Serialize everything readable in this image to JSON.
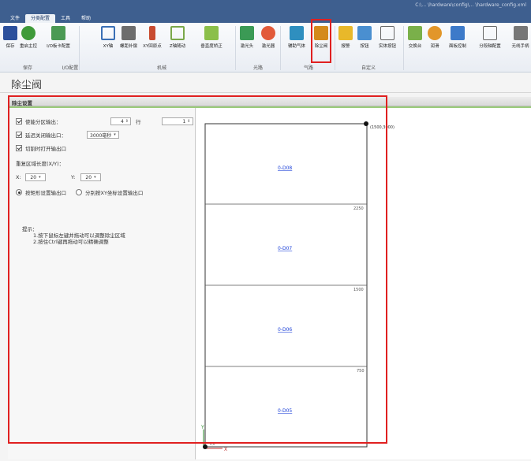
{
  "window": {
    "path_text": "C:\\... \\hardware\\config\\... \\hardware_config.xml"
  },
  "tabs": [
    "文件",
    "分类配置",
    "工具",
    "帮助"
  ],
  "ribbon": {
    "buttons": [
      "保存",
      "重启主控",
      "I/O板卡配置",
      "XY轴",
      "螺距补偿",
      "XY回原点",
      "Z轴随动",
      "垂直度矫正",
      "激光头",
      "激光器",
      "辅助气体",
      "除尘阀",
      "报警",
      "按钮",
      "实体按钮",
      "交换台",
      "润滑",
      "面板控制",
      "分段轴配置",
      "无线手柄"
    ],
    "groups": [
      "保存",
      "I/O配置",
      "机械",
      "光路",
      "气路",
      "自定义"
    ]
  },
  "page": {
    "title": "除尘阀",
    "section": "除尘设置"
  },
  "form": {
    "zone_output": {
      "label": "使能分区输出：",
      "rows": "4",
      "rows_unit": "行",
      "cols": "1",
      "cols_unit": "列"
    },
    "delay_close": {
      "label": "延迟关闭输出口：",
      "value": "3000毫秒"
    },
    "cut_open": {
      "label": "切割时打开输出口"
    },
    "repeat_len": {
      "label": "重复区域长度(X/Y)："
    },
    "x": {
      "label": "X:",
      "value": "20"
    },
    "y": {
      "label": "Y:",
      "value": "20"
    },
    "mode": {
      "option_a": "按矩形设置输出口",
      "option_b": "分别按XY坐标设置输出口"
    }
  },
  "hint": {
    "title": "提示：",
    "line1": "1.按下鼠标左键并拖动可以调整除尘区域",
    "line2": "2.按住Ctrl键再拖动可以精确调整"
  },
  "canvas": {
    "corner": "(1500,3000)",
    "tick_2250": "2250",
    "tick_1500": "1500",
    "tick_750": "750",
    "zones": [
      "0-D08",
      "0-D07",
      "0-D06",
      "0-D05"
    ],
    "origin_y": "Y",
    "origin_x": "X",
    "origin_label": "0,0",
    "colors": {
      "zone_link": "#1a3fd8",
      "frame": "#333333"
    }
  }
}
